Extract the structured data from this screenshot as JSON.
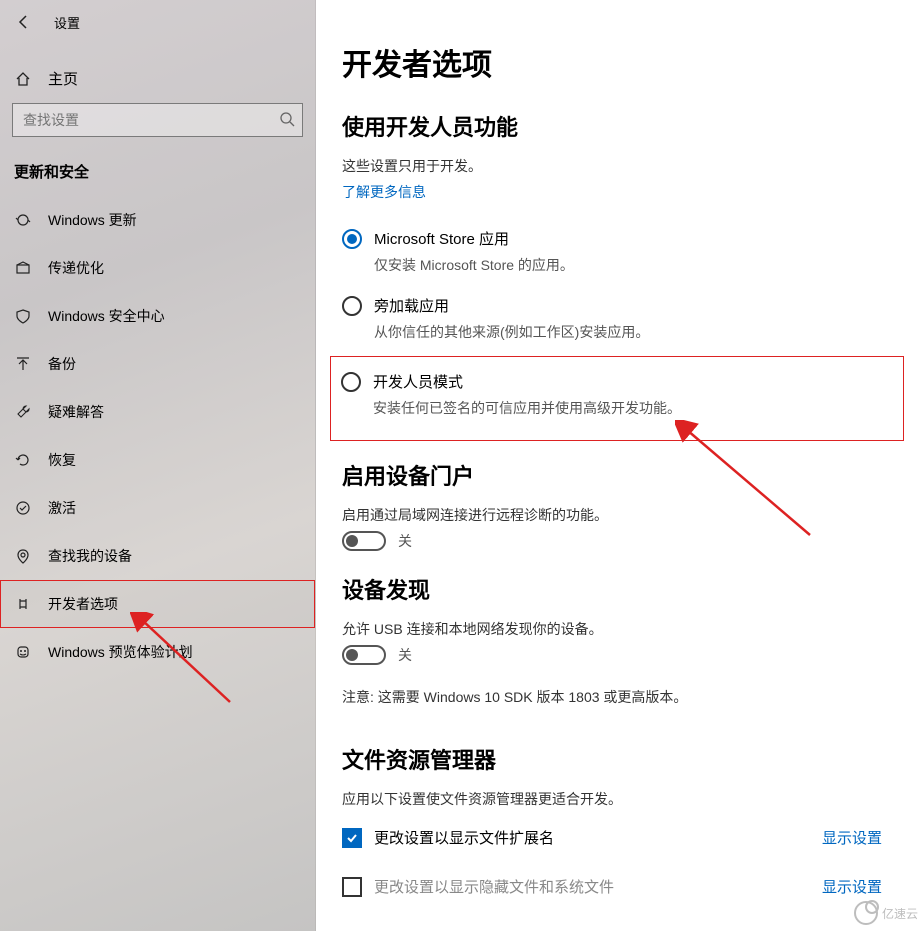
{
  "header": {
    "back_icon": "←",
    "title": "设置"
  },
  "home": {
    "label": "主页"
  },
  "search": {
    "placeholder": "查找设置"
  },
  "section_title": "更新和安全",
  "nav": [
    {
      "id": "windows-update",
      "label": "Windows 更新"
    },
    {
      "id": "delivery-opt",
      "label": "传递优化"
    },
    {
      "id": "windows-security",
      "label": "Windows 安全中心"
    },
    {
      "id": "backup",
      "label": "备份"
    },
    {
      "id": "troubleshoot",
      "label": "疑难解答"
    },
    {
      "id": "recovery",
      "label": "恢复"
    },
    {
      "id": "activation",
      "label": "激活"
    },
    {
      "id": "find-my-device",
      "label": "查找我的设备"
    },
    {
      "id": "developer-options",
      "label": "开发者选项"
    },
    {
      "id": "insider",
      "label": "Windows 预览体验计划"
    }
  ],
  "page": {
    "title": "开发者选项",
    "section1": {
      "heading": "使用开发人员功能",
      "desc": "这些设置只用于开发。",
      "link": "了解更多信息"
    },
    "radios": [
      {
        "title": "Microsoft Store 应用",
        "desc": "仅安装 Microsoft Store 的应用。",
        "checked": true,
        "boxed": false
      },
      {
        "title": "旁加载应用",
        "desc": "从你信任的其他来源(例如工作区)安装应用。",
        "checked": false,
        "boxed": false
      },
      {
        "title": "开发人员模式",
        "desc": "安装任何已签名的可信应用并使用高级开发功能。",
        "checked": false,
        "boxed": true
      }
    ],
    "section2": {
      "heading": "启用设备门户",
      "desc": "启用通过局域网连接进行远程诊断的功能。",
      "toggle_state": "关"
    },
    "section3": {
      "heading": "设备发现",
      "desc": "允许 USB 连接和本地网络发现你的设备。",
      "toggle_state": "关",
      "note": "注意: 这需要 Windows 10 SDK 版本 1803 或更高版本。"
    },
    "section4": {
      "heading": "文件资源管理器",
      "desc": "应用以下设置使文件资源管理器更适合开发。",
      "checks": [
        {
          "label": "更改设置以显示文件扩展名",
          "checked": true,
          "dim": false,
          "link": "显示设置"
        },
        {
          "label": "更改设置以显示隐藏文件和系统文件",
          "checked": false,
          "dim": true,
          "link": "显示设置"
        }
      ]
    }
  },
  "watermark": "亿速云"
}
